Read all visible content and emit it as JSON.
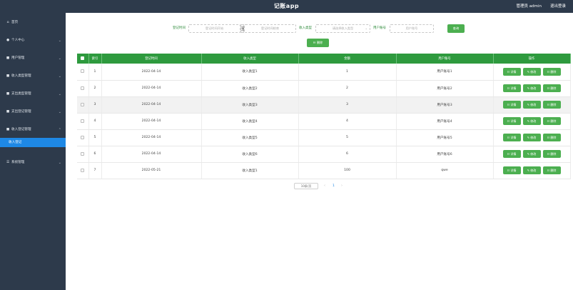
{
  "header": {
    "title": "记账app",
    "admin": "管理员 admin",
    "logout": "退出登录"
  },
  "sidebar": {
    "items": [
      {
        "icon": "⌂",
        "label": "首页",
        "chevron": ""
      },
      {
        "icon": "●",
        "label": "个人中心",
        "chevron": "⌄"
      },
      {
        "icon": "■",
        "label": "用户管理",
        "chevron": "⌄"
      },
      {
        "icon": "■",
        "label": "收入类型管理",
        "chevron": "⌄"
      },
      {
        "icon": "■",
        "label": "支出类型管理",
        "chevron": "⌄"
      },
      {
        "icon": "■",
        "label": "支出登记管理",
        "chevron": "⌄"
      },
      {
        "icon": "■",
        "label": "收入登记管理",
        "chevron": "⌃"
      }
    ],
    "subitem": "收入登记",
    "system": {
      "icon": "☰",
      "label": "系统管理",
      "chevron": "⌄"
    }
  },
  "search": {
    "time_label": "登记时间",
    "start_placeholder": "登记时间开始",
    "sep": "至",
    "end_placeholder": "登记时间结束",
    "type_label": "收入类型",
    "type_placeholder": "请选择收入类型",
    "account_label": "用户账号",
    "account_placeholder": "用户账号",
    "query_button": "查询",
    "delete_button": "☷ 删除"
  },
  "table": {
    "headers": [
      "索引",
      "登记时间",
      "收入类型",
      "金额",
      "用户账号",
      "操作"
    ],
    "ops": {
      "detail": "☷ 详情",
      "edit": "✎ 修改",
      "delete": "☷ 删除"
    },
    "rows": [
      [
        "1",
        "2022-04-14",
        "收入类型1",
        "1",
        "用户账号1"
      ],
      [
        "2",
        "2022-04-14",
        "收入类型2",
        "2",
        "用户账号2"
      ],
      [
        "3",
        "2022-04-14",
        "收入类型3",
        "3",
        "用户账号3"
      ],
      [
        "4",
        "2022-04-14",
        "收入类型4",
        "4",
        "用户账号4"
      ],
      [
        "5",
        "2022-04-14",
        "收入类型5",
        "5",
        "用户账号5"
      ],
      [
        "6",
        "2022-04-14",
        "收入类型6",
        "6",
        "用户账号6"
      ],
      [
        "7",
        "2022-05-21",
        "收入类型1",
        "100",
        "qwe"
      ]
    ]
  },
  "pager": {
    "size": "10条/页",
    "prev": "‹",
    "page": "1",
    "next": "›"
  }
}
